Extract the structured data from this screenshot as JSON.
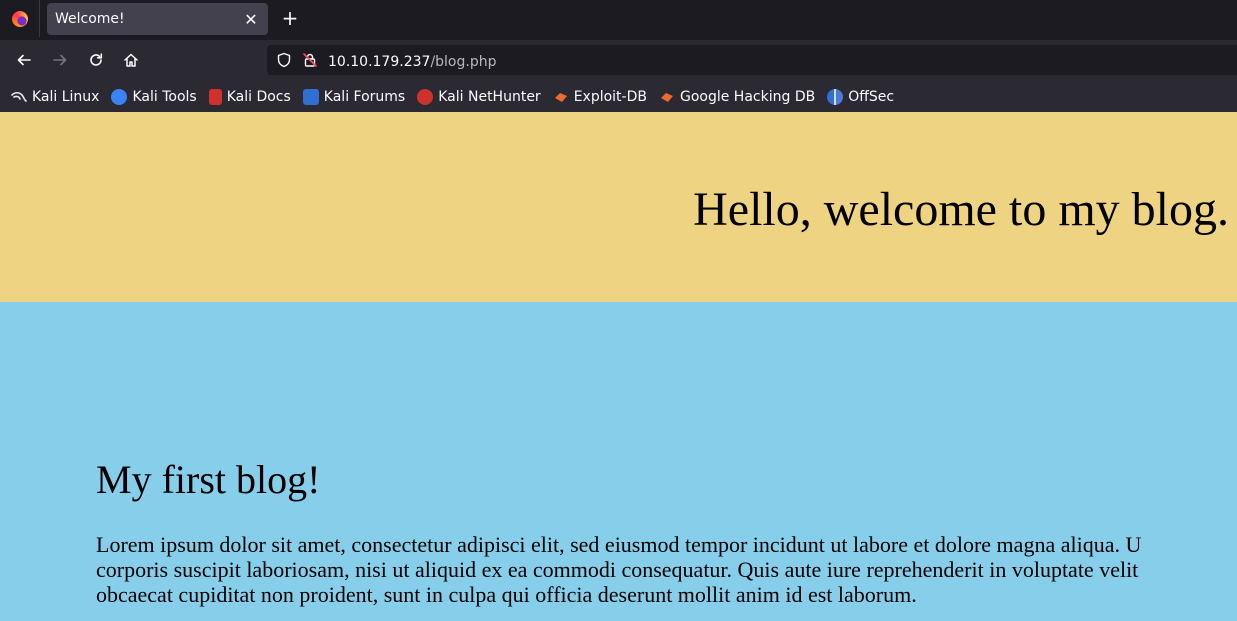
{
  "browser": {
    "tab": {
      "title": "Welcome!",
      "close_glyph": "✕"
    },
    "new_tab_glyph": "+",
    "url": {
      "host": "10.10.179.237",
      "path": "/blog.php"
    },
    "bookmarks": [
      {
        "label": "Kali Linux",
        "icon": "kali-dragon-icon",
        "color": "#e8e8ee"
      },
      {
        "label": "Kali Tools",
        "icon": "kali-tools-icon",
        "color": "#3b82f6"
      },
      {
        "label": "Kali Docs",
        "icon": "kali-docs-icon",
        "color": "#d0312d"
      },
      {
        "label": "Kali Forums",
        "icon": "kali-forums-icon",
        "color": "#2f6fd6"
      },
      {
        "label": "Kali NetHunter",
        "icon": "nethunter-icon",
        "color": "#d0312d"
      },
      {
        "label": "Exploit-DB",
        "icon": "exploit-db-icon",
        "color": "#ec6a2b"
      },
      {
        "label": "Google Hacking DB",
        "icon": "ghdb-icon",
        "color": "#ec6a2b"
      },
      {
        "label": "OffSec",
        "icon": "offsec-icon",
        "color": "#4f7bd8"
      }
    ]
  },
  "page": {
    "hero_title": "Hello, welcome to my blog.",
    "post": {
      "title": "My first blog!",
      "lines": [
        "Lorem ipsum dolor sit amet, consectetur adipisci elit, sed eiusmod tempor incidunt ut labore et dolore magna aliqua. U",
        "corporis suscipit laboriosam, nisi ut aliquid ex ea commodi consequatur. Quis aute iure reprehenderit in voluptate velit",
        "obcaecat cupiditat non proident, sunt in culpa qui officia deserunt mollit anim id est laborum."
      ]
    },
    "colors": {
      "hero_bg": "#edd382",
      "content_bg": "#87ceeb"
    }
  }
}
